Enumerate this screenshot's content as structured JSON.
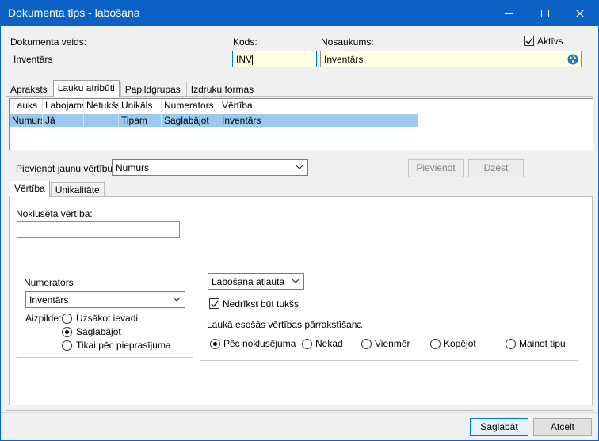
{
  "window": {
    "title": "Dokumenta tips - labošana"
  },
  "header": {
    "doc_type_label": "Dokumenta veids:",
    "doc_type_value": "Inventārs",
    "code_label": "Kods:",
    "code_value": "INV",
    "name_label": "Nosaukums:",
    "name_value": "Inventārs",
    "active_label": "Aktīvs",
    "active_checked": true
  },
  "tabs": [
    {
      "label": "Apraksts",
      "active": false
    },
    {
      "label": "Lauku atribūti",
      "active": true
    },
    {
      "label": "Papildgrupas",
      "active": false
    },
    {
      "label": "Izdruku formas",
      "active": false
    }
  ],
  "table": {
    "columns": [
      "Lauks",
      "Labojams",
      "Netukšs",
      "Unikāls",
      "Numerators",
      "Vērtība"
    ],
    "rows": [
      [
        "Numurs",
        "Jā",
        "",
        "Tipam",
        "Saglabājot",
        "Inventārs"
      ]
    ]
  },
  "add_value": {
    "label": "Pievienot jaunu vērtību:",
    "selected": "Numurs",
    "add_button": "Pievienot",
    "delete_button": "Dzēst"
  },
  "subtabs": [
    {
      "label": "Vērtība",
      "active": true
    },
    {
      "label": "Unikalitāte",
      "active": false
    }
  ],
  "value_tab": {
    "default_label": "Noklusētā vērtība:",
    "default_value": "",
    "numerator_group": "Numerators",
    "numerator_selected": "Inventārs",
    "fill_label": "Aizpilde:",
    "fill_options": [
      "Uzsākot ievadi",
      "Saglabājot",
      "Tikai pēc pieprasījuma"
    ],
    "fill_selected_index": 1,
    "edit_selected": "Labošana atļauta",
    "not_empty_label": "Nedrīkst būt tukšs",
    "not_empty_checked": true,
    "overwrite_group": "Laukā esošās vērtības pārrakstīšana",
    "overwrite_options": [
      "Pēc noklusējuma",
      "Nekad",
      "Vienmēr",
      "Kopējot",
      "Mainot tipu"
    ],
    "overwrite_selected_index": 0
  },
  "footer": {
    "save_button": "Saglabāt",
    "cancel_button": "Atcelt"
  },
  "icons": {
    "globe": "globe-icon",
    "minimize": "minimize-icon",
    "maximize": "maximize-icon",
    "close": "close-icon"
  },
  "colors": {
    "titlebar": "#0b62c4",
    "selected_row": "#99c9ef",
    "required_field": "#ffffe1"
  }
}
